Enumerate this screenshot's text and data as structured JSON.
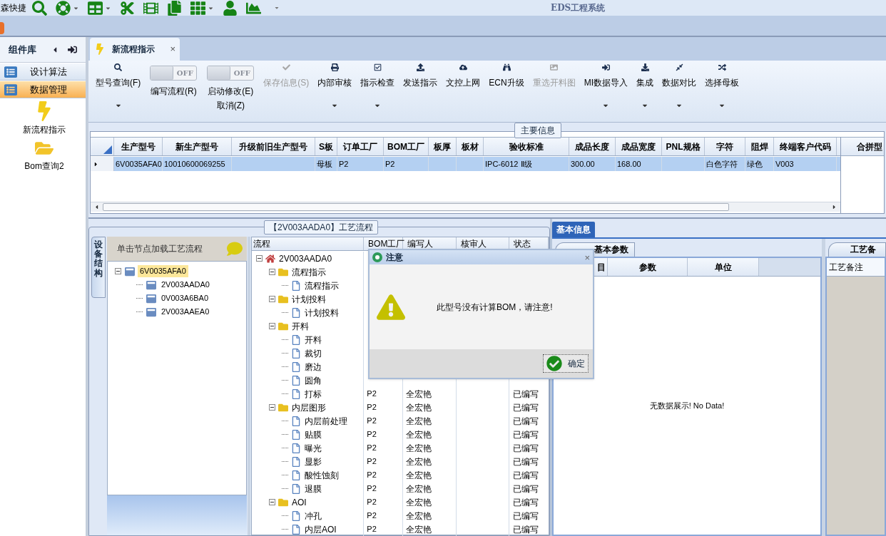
{
  "quick_access": {
    "label": "森快捷",
    "tools": [
      {
        "dropdown": false
      },
      {
        "dropdown": true
      },
      {
        "dropdown": true
      },
      {
        "dropdown": false
      },
      {
        "dropdown": false
      },
      {
        "dropdown": false
      },
      {
        "dropdown": true
      },
      {
        "dropdown": false
      },
      {
        "dropdown": false
      }
    ]
  },
  "window": {
    "title": "EDS工程系统"
  },
  "sidebar": {
    "title": "组件库",
    "groups": [
      {
        "label": "设计算法",
        "selected": false
      },
      {
        "label": "数据管理",
        "selected": true
      }
    ],
    "items": [
      {
        "label": "新流程指示"
      },
      {
        "label": "Bom查询2"
      }
    ]
  },
  "document_tabs": [
    {
      "label": "新流程指示",
      "selected": true,
      "close": "×"
    }
  ],
  "ribbon": [
    {
      "kind": "button",
      "label": "型号查询(F)",
      "disabled": false,
      "dropdown": true
    },
    {
      "kind": "toggle",
      "text": "OFF",
      "on": false,
      "label": "编写流程(R)"
    },
    {
      "kind": "toggle",
      "text": "OFF",
      "on": false,
      "label": "启动修改(E)",
      "label2": "取消(Z)"
    },
    {
      "kind": "button",
      "label": "保存信息(S)",
      "disabled": true,
      "dropdown": false
    },
    {
      "kind": "button",
      "label": "内部审核",
      "disabled": false,
      "dropdown": true
    },
    {
      "kind": "button",
      "label": "指示检查",
      "disabled": false,
      "dropdown": true
    },
    {
      "kind": "button",
      "label": "发送指示",
      "disabled": false,
      "dropdown": false
    },
    {
      "kind": "button",
      "label": "文控上网",
      "disabled": false,
      "dropdown": false
    },
    {
      "kind": "button",
      "label": "ECN升级",
      "disabled": false,
      "dropdown": false
    },
    {
      "kind": "button",
      "label": "重选开料图",
      "disabled": true,
      "dropdown": false
    },
    {
      "kind": "button",
      "label": "MI数据导入",
      "disabled": false,
      "dropdown": true
    },
    {
      "kind": "button",
      "label": "集成",
      "disabled": false,
      "dropdown": true
    },
    {
      "kind": "button",
      "label": "数据对比",
      "disabled": false,
      "dropdown": true
    },
    {
      "kind": "button",
      "label": "选择母板",
      "disabled": false,
      "dropdown": true
    }
  ],
  "main_info": {
    "title": "主要信息",
    "columns": [
      "生产型号",
      "新生产型号",
      "升级前旧生产型号",
      "S板",
      "订单工厂",
      "BOM工厂",
      "板厚",
      "板材",
      "验收标准",
      "成品长度",
      "成品宽度",
      "PNL规格",
      "字符",
      "阻焊",
      "终端客户代码"
    ],
    "rows": [
      {
        "selected": true,
        "cells": [
          "6V0035AFA0",
          "10010600069255",
          null,
          "母板",
          "P2",
          "P2",
          null,
          null,
          "IPC-6012 Ⅱ级",
          "300.00",
          "168.00",
          null,
          "白色字符",
          "绿色",
          "V003"
        ]
      }
    ],
    "side_column": "合拼型"
  },
  "process_flow": {
    "title": "【2V003AADA0】工艺流程",
    "equipment": {
      "tab": "设备结构",
      "hint": "单击节点加载工艺流程",
      "nodes": [
        {
          "label": "6V0035AFA0",
          "selected": true,
          "expanded": true,
          "children": [
            {
              "label": "2V003AADA0",
              "selected": false
            },
            {
              "label": "0V003A6BA0",
              "selected": false
            },
            {
              "label": "2V003AAEA0",
              "selected": false
            }
          ]
        }
      ]
    },
    "columns": [
      "流程",
      "BOM工厂",
      "编写人",
      "核审人",
      "状态"
    ],
    "tree": [
      {
        "label": "2V003AADA0",
        "kind": "root",
        "expanded": true,
        "children": [
          {
            "label": "流程指示",
            "kind": "folder",
            "expanded": true,
            "children": [
              {
                "label": "流程指示",
                "kind": "step"
              }
            ]
          },
          {
            "label": "计划投料",
            "kind": "folder",
            "expanded": true,
            "children": [
              {
                "label": "计划投料",
                "kind": "step"
              }
            ]
          },
          {
            "label": "开料",
            "kind": "folder",
            "expanded": true,
            "children": [
              {
                "label": "开料",
                "kind": "step"
              },
              {
                "label": "裁切",
                "kind": "step"
              },
              {
                "label": "磨边",
                "kind": "step"
              },
              {
                "label": "圆角",
                "kind": "step"
              },
              {
                "label": "打标",
                "kind": "step",
                "bom": "P2",
                "writer": "全宏艳",
                "status": "已编写"
              }
            ]
          },
          {
            "label": "内层图形",
            "kind": "folder",
            "expanded": true,
            "bom": "P2",
            "writer": "全宏艳",
            "status": "已编写",
            "children": [
              {
                "label": "内层前处理",
                "kind": "step",
                "bom": "P2",
                "writer": "全宏艳",
                "status": "已编写"
              },
              {
                "label": "贴膜",
                "kind": "step",
                "bom": "P2",
                "writer": "全宏艳",
                "status": "已编写"
              },
              {
                "label": "曝光",
                "kind": "step",
                "bom": "P2",
                "writer": "全宏艳",
                "status": "已编写"
              },
              {
                "label": "显影",
                "kind": "step",
                "bom": "P2",
                "writer": "全宏艳",
                "status": "已编写"
              },
              {
                "label": "酸性蚀刻",
                "kind": "step",
                "bom": "P2",
                "writer": "全宏艳",
                "status": "已编写"
              },
              {
                "label": "退膜",
                "kind": "step",
                "bom": "P2",
                "writer": "全宏艳",
                "status": "已编写"
              }
            ]
          },
          {
            "label": "AOI",
            "kind": "folder",
            "expanded": true,
            "bom": "P2",
            "writer": "全宏艳",
            "status": "已编写",
            "children": [
              {
                "label": "冲孔",
                "kind": "step",
                "bom": "P2",
                "writer": "全宏艳",
                "status": "已编写"
              },
              {
                "label": "内层AOI",
                "kind": "step",
                "bom": "P2",
                "writer": "全宏艳",
                "status": "已编写"
              }
            ]
          }
        ]
      }
    ]
  },
  "basic_info": {
    "tabs": [
      {
        "label": "基本信息",
        "selected": true
      }
    ],
    "params": {
      "tab": "基本参数",
      "columns": [
        "目",
        "参数",
        "单位"
      ],
      "empty": "无数据展示! No Data!"
    },
    "notes": {
      "tab": "工艺备",
      "column": "工艺备注"
    }
  },
  "dialog": {
    "title": "注意",
    "close": "×",
    "message": "此型号没有计算BOM，请注意!",
    "ok": "确定"
  }
}
